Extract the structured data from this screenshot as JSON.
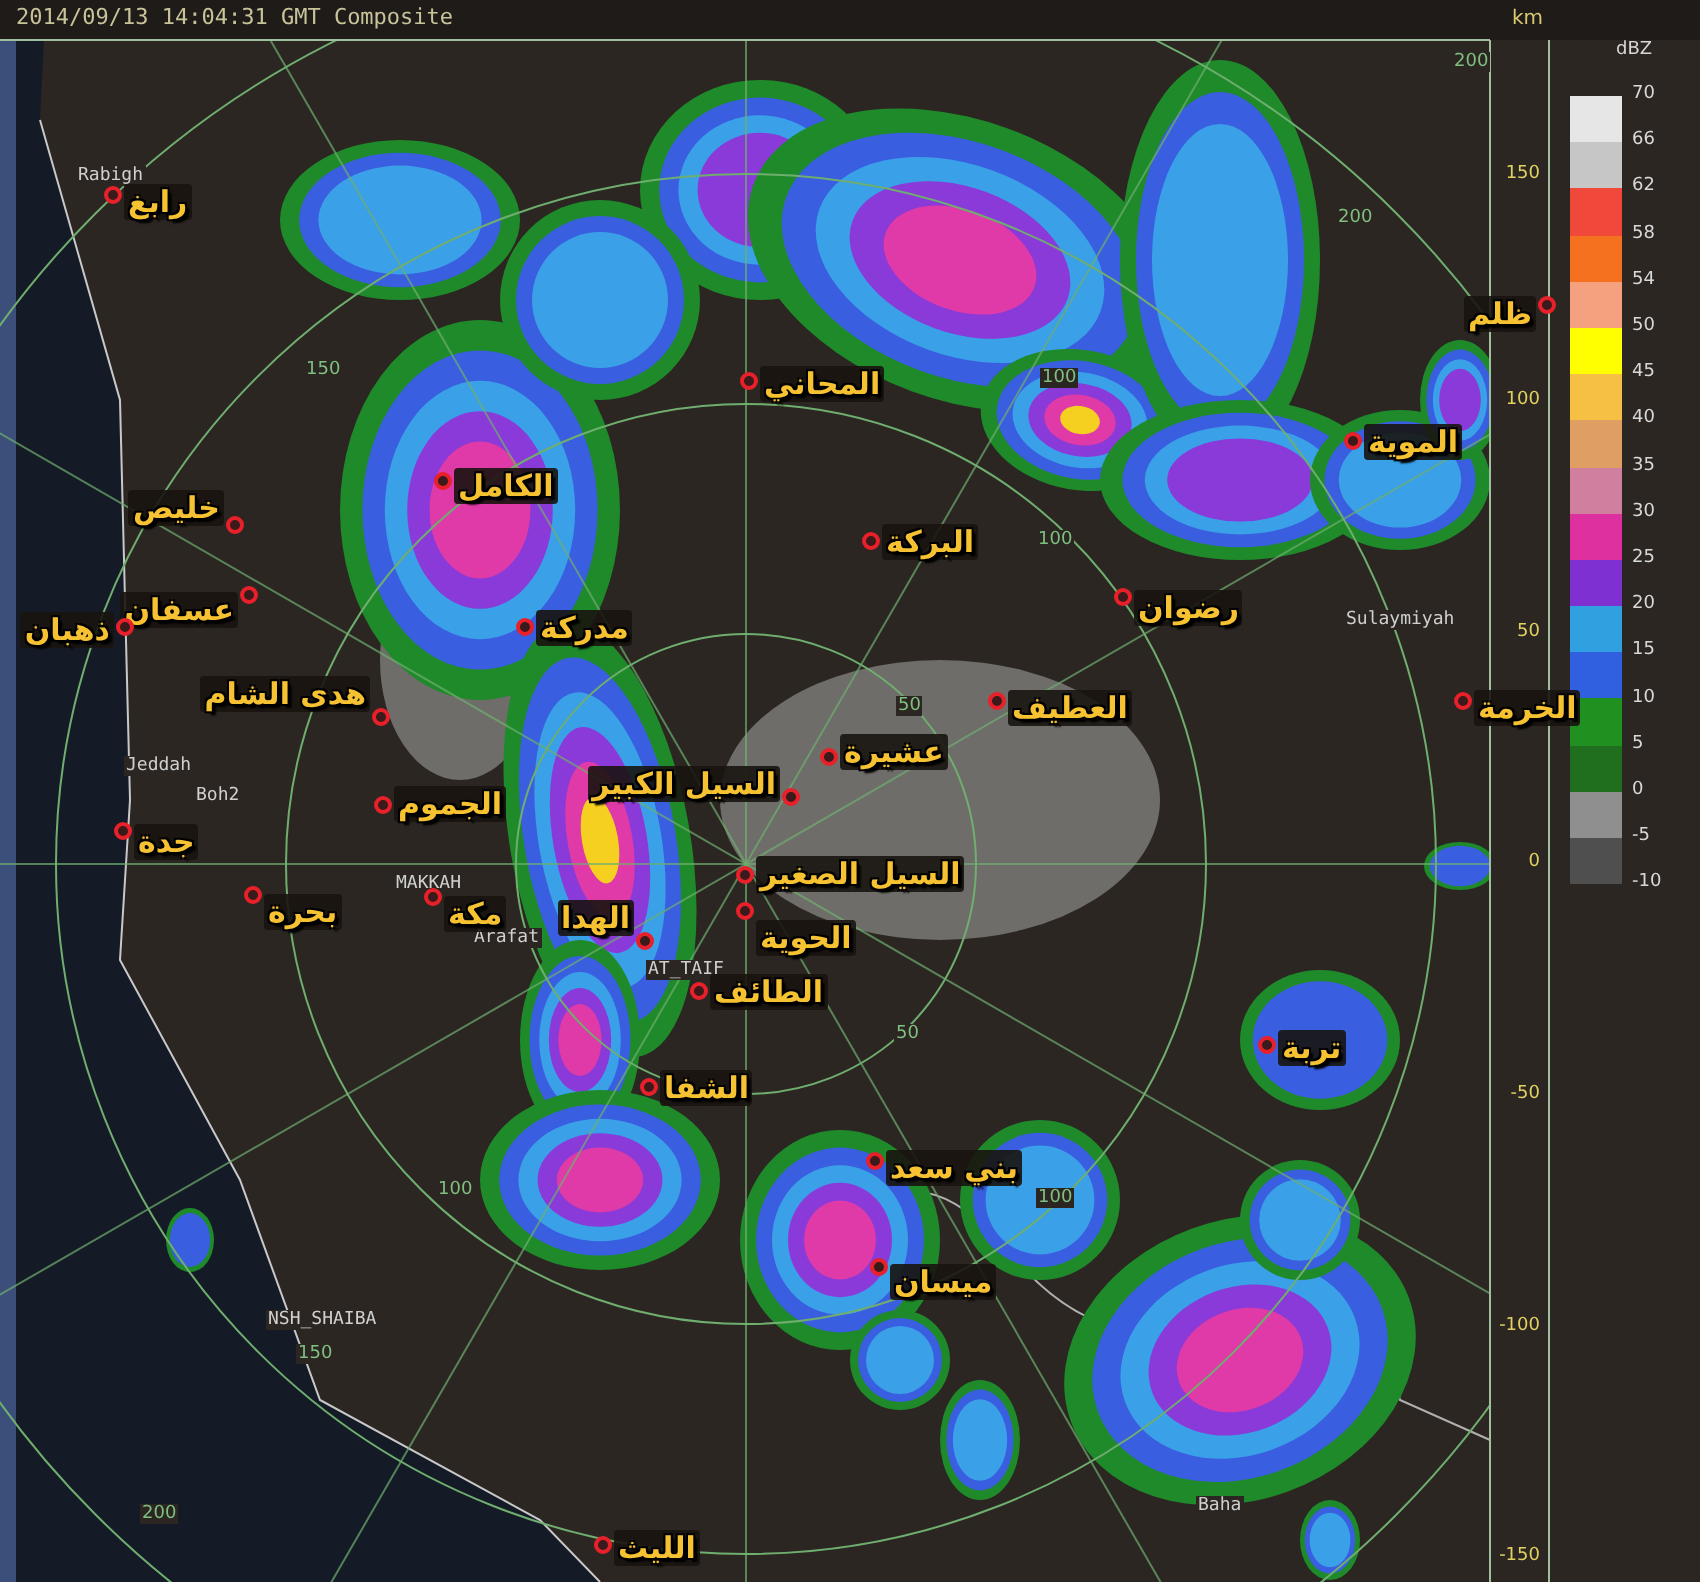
{
  "header": "2014/09/13 14:04:31 GMT Composite",
  "axis": {
    "unit": "km",
    "ticks": [
      "150",
      "100",
      "50",
      "0",
      "-50",
      "-100",
      "-150"
    ]
  },
  "legend": {
    "unit": "dBZ",
    "bottom_label": "-10",
    "bands": [
      {
        "label": "70",
        "color": "#e6e6e6"
      },
      {
        "label": "66",
        "color": "#c6c6c6"
      },
      {
        "label": "62",
        "color": "#f0483a"
      },
      {
        "label": "58",
        "color": "#f5701f"
      },
      {
        "label": "54",
        "color": "#f5a07e"
      },
      {
        "label": "50",
        "color": "#ffff00"
      },
      {
        "label": "45",
        "color": "#f5c043"
      },
      {
        "label": "40",
        "color": "#df9f62"
      },
      {
        "label": "35",
        "color": "#d07f9f"
      },
      {
        "label": "30",
        "color": "#df30a0"
      },
      {
        "label": "25",
        "color": "#7f30d0"
      },
      {
        "label": "20",
        "color": "#30a0e0"
      },
      {
        "label": "15",
        "color": "#3060e0"
      },
      {
        "label": "10",
        "color": "#209020"
      },
      {
        "label": "5",
        "color": "#1f6f1f"
      },
      {
        "label": "0",
        "color": "#8f8f8f"
      },
      {
        "label": "-5",
        "color": "#4f4f4f"
      }
    ]
  },
  "cities": [
    "رابغ",
    "المحاني",
    "الكامل",
    "خليص",
    "عسفان",
    "ذهبان",
    "مدركة",
    "هدى الشام",
    "الجموم",
    "جدة",
    "مكة",
    "بحرة",
    "السيل الكبير",
    "عشيرة",
    "السيل الصغير",
    "الهدا",
    "الحوية",
    "الطائف",
    "الشفا",
    "بني سعد",
    "ميسان",
    "الليث",
    "البركة",
    "رضوان",
    "العطيف",
    "الموية",
    "ظلم",
    "الخرمة",
    "تربة"
  ],
  "place_labels": [
    "Rabigh",
    "Jeddah",
    "Boh2",
    "MAKKAH",
    "Arafat",
    "AT_TAIF",
    "NSH_SHAIBA",
    "Sulaymiyah",
    "Baha"
  ],
  "ring_labels": [
    "200",
    "150",
    "100",
    "200",
    "100",
    "50",
    "100",
    "150",
    "200",
    "50",
    "100"
  ]
}
